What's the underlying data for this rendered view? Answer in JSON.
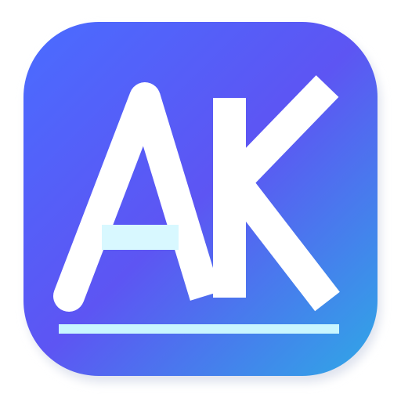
{
  "app_icon": {
    "monogram": "AK",
    "icon_name": "ak-monogram-app-icon",
    "colors": {
      "gradient_start": "#4a6cff",
      "gradient_mid": "#5d55f3",
      "gradient_end": "#2fa8e6",
      "glyph": "#ffffff",
      "accent_bar": "#d8f8ff",
      "underline": "#c9f6ff",
      "shadow": "#dfe3ee"
    }
  }
}
